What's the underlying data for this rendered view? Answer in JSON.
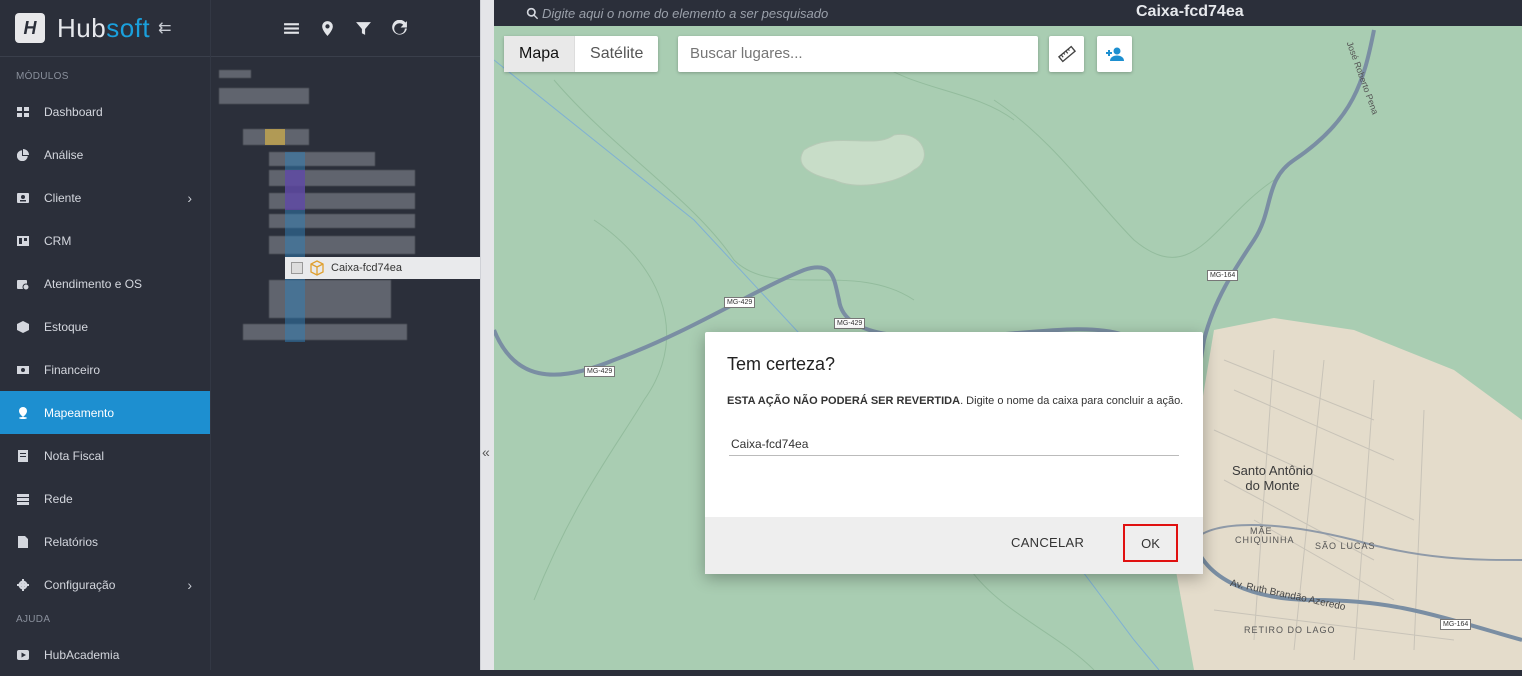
{
  "brand": {
    "prefix": "Hub",
    "suffix": "soft",
    "collapse_glyph": "⇇"
  },
  "sidebar": {
    "section_modules": "MÓDULOS",
    "items": [
      {
        "label": "Dashboard",
        "icon": "dashboard-icon",
        "active": false,
        "has_submenu": false
      },
      {
        "label": "Análise",
        "icon": "pie-chart-icon",
        "active": false,
        "has_submenu": false
      },
      {
        "label": "Cliente",
        "icon": "contact-card-icon",
        "active": false,
        "has_submenu": true
      },
      {
        "label": "CRM",
        "icon": "board-icon",
        "active": false,
        "has_submenu": false
      },
      {
        "label": "Atendimento e OS",
        "icon": "calendar-clock-icon",
        "active": false,
        "has_submenu": false
      },
      {
        "label": "Estoque",
        "icon": "cube-icon",
        "active": false,
        "has_submenu": false
      },
      {
        "label": "Financeiro",
        "icon": "money-icon",
        "active": false,
        "has_submenu": false
      },
      {
        "label": "Mapeamento",
        "icon": "map-pin-icon",
        "active": true,
        "has_submenu": false
      },
      {
        "label": "Nota Fiscal",
        "icon": "receipt-icon",
        "active": false,
        "has_submenu": false
      },
      {
        "label": "Rede",
        "icon": "server-icon",
        "active": false,
        "has_submenu": false
      },
      {
        "label": "Relatórios",
        "icon": "document-icon",
        "active": false,
        "has_submenu": false
      },
      {
        "label": "Configuração",
        "icon": "gear-icon",
        "active": false,
        "has_submenu": true
      }
    ],
    "section_help": "AJUDA",
    "help_items": [
      {
        "label": "HubAcademia",
        "icon": "play-icon"
      }
    ],
    "chevron": "›"
  },
  "tree": {
    "selected_node": "Caixa-fcd74ea",
    "selected_icon": "box-icon"
  },
  "splitter_glyph": "«",
  "map": {
    "search_placeholder": "Digite aqui o nome do elemento a ser pesquisado",
    "title": "Caixa-fcd74ea",
    "map_type_options": [
      "Mapa",
      "Satélite"
    ],
    "map_type_selected": "Mapa",
    "places_placeholder": "Buscar lugares...",
    "road_labels": [
      "MG-429",
      "MG-429",
      "MG-429",
      "MG-164",
      "MG-164"
    ],
    "street_labels": [
      "José Roberto Pena",
      "Av. Ruth Brandão Azeredo"
    ],
    "place_labels": [
      "Santo Antônio",
      "do Monte"
    ],
    "neighborhood_labels": [
      "MÃE",
      "CHIQUINHA",
      "SÃO LUCAS",
      "RETIRO DO LAGO"
    ],
    "colors": {
      "map_bg": "#a9cdb2",
      "road": "#7a8ea3",
      "town": "#e8dcc8"
    }
  },
  "modal": {
    "title": "Tem certeza?",
    "warning_bold": "ESTA AÇÃO NÃO PODERÁ SER REVERTIDA",
    "warning_rest": ". Digite o nome da caixa para concluir a ação.",
    "input_value": "Caixa-fcd74ea",
    "cancel_label": "CANCELAR",
    "ok_label": "OK",
    "highlight_color": "#e01010"
  }
}
